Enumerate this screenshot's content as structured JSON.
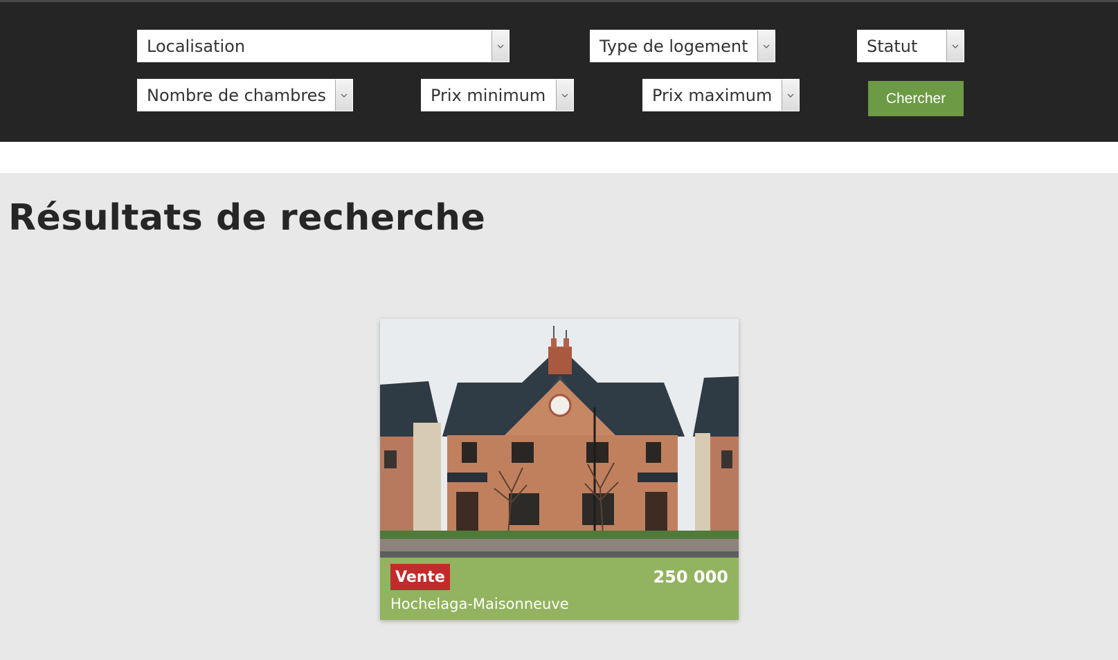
{
  "filters": {
    "location": "Localisation",
    "housing_type": "Type de logement",
    "status": "Statut",
    "bedrooms": "Nombre de chambres",
    "min_price": "Prix minimum",
    "max_price": "Prix maximum",
    "search_label": "Chercher"
  },
  "page": {
    "title": "Résultats de recherche"
  },
  "results": [
    {
      "badge": "Vente",
      "price": "250 000",
      "location": "Hochelaga-Maisonneuve",
      "image": "brick-house-photo"
    }
  ],
  "colors": {
    "header_bg": "#252525",
    "button": "#6d9a45",
    "card": "#92b35f",
    "badge": "#c22b2b",
    "page_bg": "#e8e8e8"
  },
  "icons": {
    "dropdown": "chevron-down-icon"
  }
}
